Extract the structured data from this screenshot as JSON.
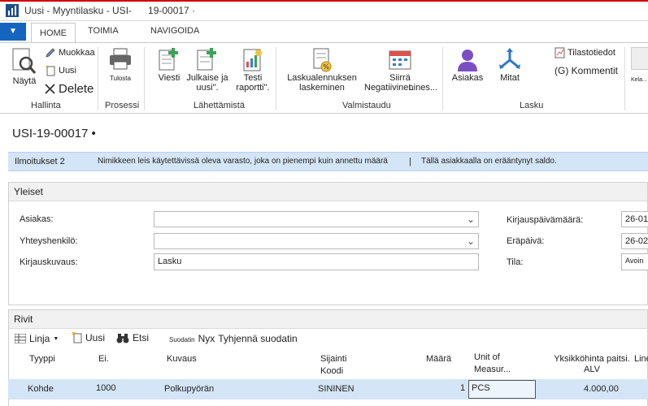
{
  "window": {
    "title": "Uusi - Myyntilasku - USI-      19-00017 ·"
  },
  "tabs": [
    "HOME",
    "TOIMIA",
    "NAVIGOIDA"
  ],
  "ribbon": {
    "nayta": "Näytä",
    "muokkaa": "Muokkaa",
    "uusi": "Uusi",
    "delete": "Delete",
    "tulosta": "Tulosta",
    "viesti": "Viesti",
    "julkaise_1": "Julkaise ja",
    "julkaise_2": "uusi\".",
    "testi_1": "Testi",
    "testi_2": "raportti\".",
    "laskualennus_1": "Laskualennuksen",
    "laskualennus_2": "laskeminen",
    "siirra_1": "Siirrä",
    "siirra_2": "Negatiivinen",
    "lines": "Lines...",
    "asiakas": "Asiakas",
    "mitat": "Mitat",
    "tilastotiedot": "Tilastotiedot",
    "kommentit": "(G) Kommentit",
    "kela": "Kela..."
  },
  "groups": {
    "hallinta": "Hallinta",
    "prosessi": "Prosessi",
    "lahettamista": "Lähettämistä",
    "valmistaudu": "Valmistaudu",
    "lasku": "Lasku"
  },
  "document": {
    "title": "USI-19-00017 •"
  },
  "notifications": {
    "count": "Ilmoitukset 2",
    "msg1": "Nimikkeen leis käytettävissä oleva varasto, joka on pienempi kuin annettu määrä",
    "sep": "|",
    "msg2": "Tällä asiakkaalla on erääntynyt saldo."
  },
  "general": {
    "header": "Yleiset",
    "asiakas_label": "Asiakas:",
    "asiakas_value": "",
    "yhteyshenkilo_label": "Yhteyshenkilö:",
    "yhteyshenkilo_value": "",
    "kirjauskuvaus_label": "Kirjauskuvaus:",
    "kirjauskuvaus_value": "Lasku",
    "kirjauspvm_label": "Kirjauspäivämäärä:",
    "kirjauspvm_value": "26-01",
    "erapaiva_label": "Eräpäivä:",
    "erapaiva_value": "26-02",
    "tila_label": "Tila:",
    "tila_value": "Avoin"
  },
  "lines": {
    "header": "Rivit",
    "toolbar": {
      "linja": "Linja",
      "uusi": "Uusi",
      "etsi": "Etsi",
      "suodatin": "Suodatin",
      "nyx": "Nyx",
      "tyhjenna": "Tyhjennä suodatin"
    },
    "columns": {
      "tyyppi": "Tyyppi",
      "ei": "Ei.",
      "kuvaus": "Kuvaus",
      "sijainti_1": "Sijainti",
      "sijainti_2": "Koodi",
      "maara": "Määrä",
      "unit_1": "Unit of",
      "unit_2": "Measur...",
      "yksikkohinta_1": "Yksikköhinta paitsi.",
      "yksikkohinta_2": "ALV",
      "line": "Line"
    },
    "rows": [
      {
        "tyyppi": "Kohde",
        "ei": "1000",
        "kuvaus": "Polkupyörän",
        "sijainti": "SININEN",
        "maara": "1",
        "unit": "PCS",
        "hinta": "4.000,00"
      }
    ]
  },
  "colors": {
    "accent": "#1565c0",
    "notification_bg": "#d4e5f7",
    "selection_bg": "#d4e5f7"
  }
}
